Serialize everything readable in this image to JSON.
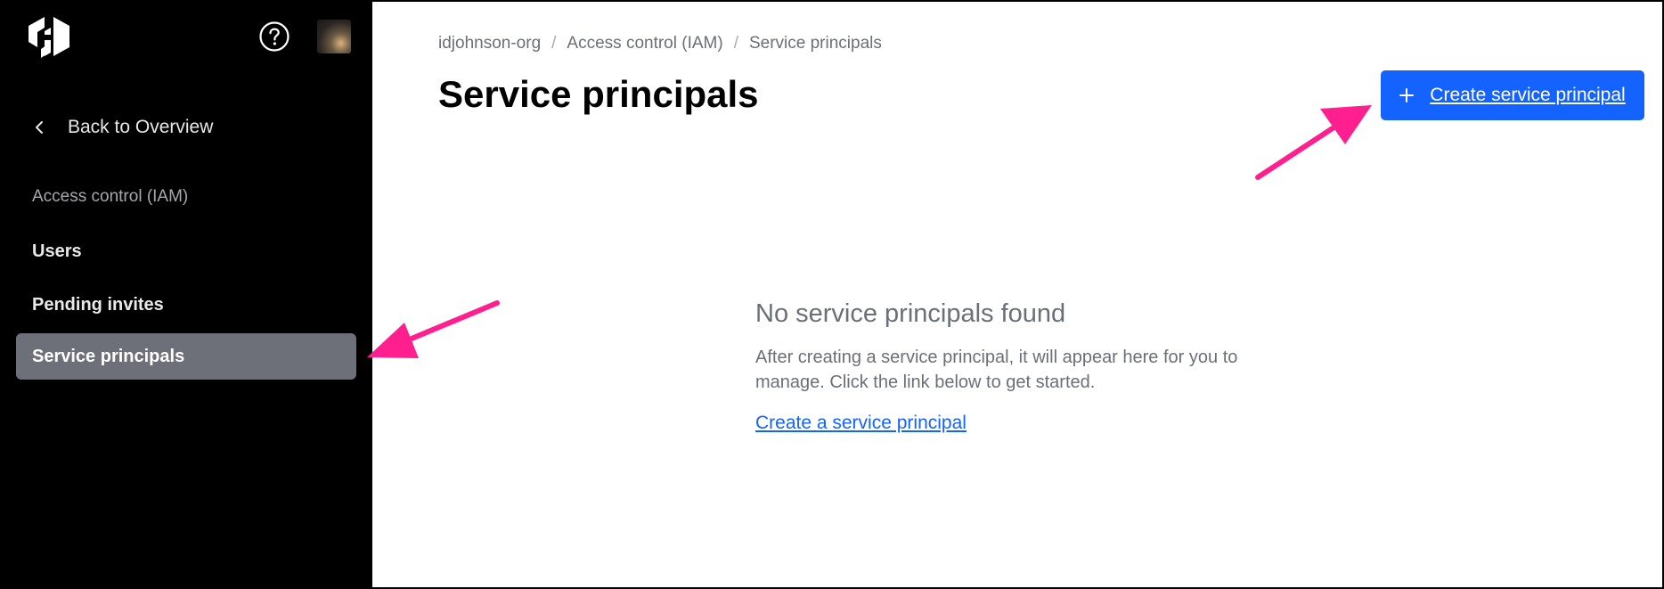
{
  "sidebar": {
    "back_label": "Back to Overview",
    "section_title": "Access control (IAM)",
    "items": [
      {
        "label": "Users",
        "active": false
      },
      {
        "label": "Pending invites",
        "active": false
      },
      {
        "label": "Service principals",
        "active": true
      }
    ]
  },
  "header": {
    "logo_icon": "hashicorp-logo-icon",
    "help_icon": "help-circle-icon",
    "avatar": "user-avatar"
  },
  "breadcrumb": [
    "idjohnson-org",
    "Access control (IAM)",
    "Service principals"
  ],
  "main": {
    "title": "Service principals",
    "create_button_label": "Create service principal",
    "empty_state": {
      "title": "No service principals found",
      "body": "After creating a service principal, it will appear here for you to manage. Click the link below to get started.",
      "link": "Create a service principal"
    }
  },
  "colors": {
    "sidebar_bg": "#000000",
    "active_item_bg": "#6e7079",
    "primary": "#1563ff",
    "annotation_arrow": "#ff1f8e"
  }
}
